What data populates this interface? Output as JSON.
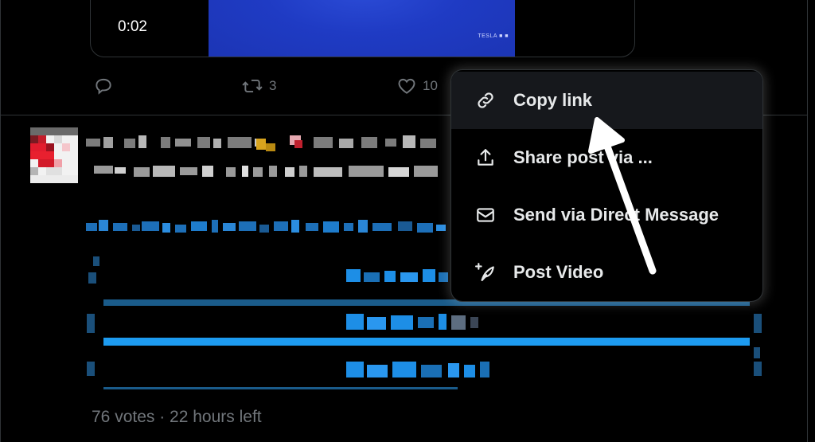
{
  "video": {
    "timestamp": "0:02",
    "watermark": "TESLA ■ ■"
  },
  "actions": {
    "reply_icon": "reply-icon",
    "repost_icon": "repost-icon",
    "repost_count": "3",
    "like_icon": "heart-icon",
    "like_count": "10"
  },
  "poll": {
    "meta": "76 votes · 22 hours left"
  },
  "share_menu": {
    "items": [
      {
        "label": "Copy link",
        "icon": "link-icon"
      },
      {
        "label": "Share post via ...",
        "icon": "share-icon"
      },
      {
        "label": "Send via Direct Message",
        "icon": "envelope-icon"
      },
      {
        "label": "Post Video",
        "icon": "post-video-icon"
      }
    ]
  },
  "colors": {
    "background": "#000000",
    "accent": "#1d9bf0",
    "muted_text": "#71767b",
    "menu_hover": "#16181c"
  }
}
